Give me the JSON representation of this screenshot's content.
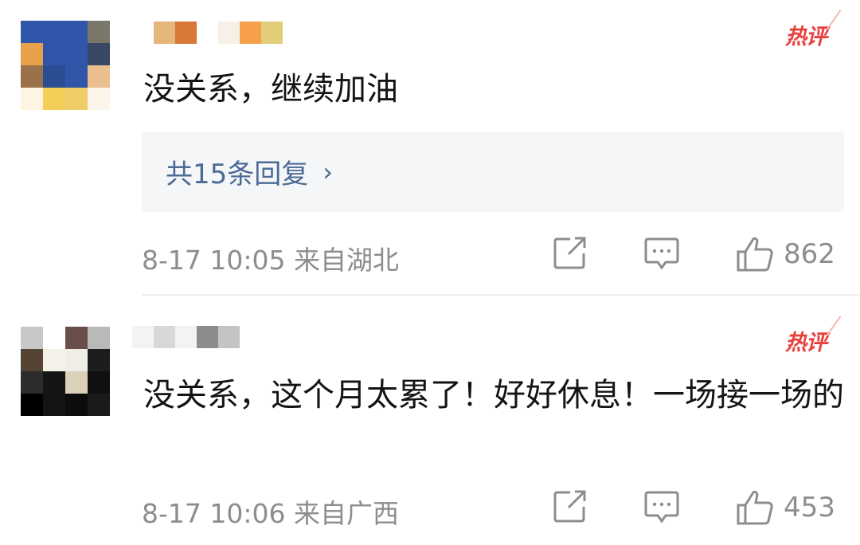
{
  "comments": [
    {
      "text": "没关系，继续加油",
      "badge": "热评",
      "reply_summary": "共15条回复",
      "reply_chevron": "›",
      "time": "8-17 10:05",
      "location": "来自湖北",
      "likes": "862",
      "avatar_colors": [
        "#2f56a8",
        "#2f56a8",
        "#2f56a8",
        "#7a786a",
        "#e7a14b",
        "#2f56a8",
        "#2f56a8",
        "#394864",
        "#9a7148",
        "#2a4c93",
        "#2f56a8",
        "#ebbe90",
        "#fdf4e3",
        "#f3cf5a",
        "#eecd66",
        "#fbf5ea"
      ],
      "name_colors": [
        "#ffffff",
        "#e5b57c",
        "#d87736",
        "#ffffff",
        "#f6f0e6",
        "#f6a04a",
        "#e2cd78"
      ]
    },
    {
      "text": "没关系，这个月太累了！好好休息！一场接一场的",
      "badge": "热评",
      "time": "8-17 10:06",
      "location": "来自广西",
      "likes": "453",
      "avatar_colors": [
        "#c8c8c8",
        "#ffffff",
        "#6a4e4a",
        "#b9b9b9",
        "#554433",
        "#f4f0ea",
        "#f0ede6",
        "#1d1d1d",
        "#2c2c2c",
        "#151515",
        "#ddd0bb",
        "#101010",
        "#000000",
        "#141414",
        "#0c0c0c",
        "#1a1a1a"
      ],
      "name_colors": [
        "#f3f3f3",
        "#d8d8d8",
        "#f3f3f3",
        "#8c8c8c",
        "#c4c4c4"
      ]
    }
  ],
  "icons": {
    "share": "share-icon",
    "comment": "comment-icon",
    "like": "thumbs-up-icon"
  }
}
